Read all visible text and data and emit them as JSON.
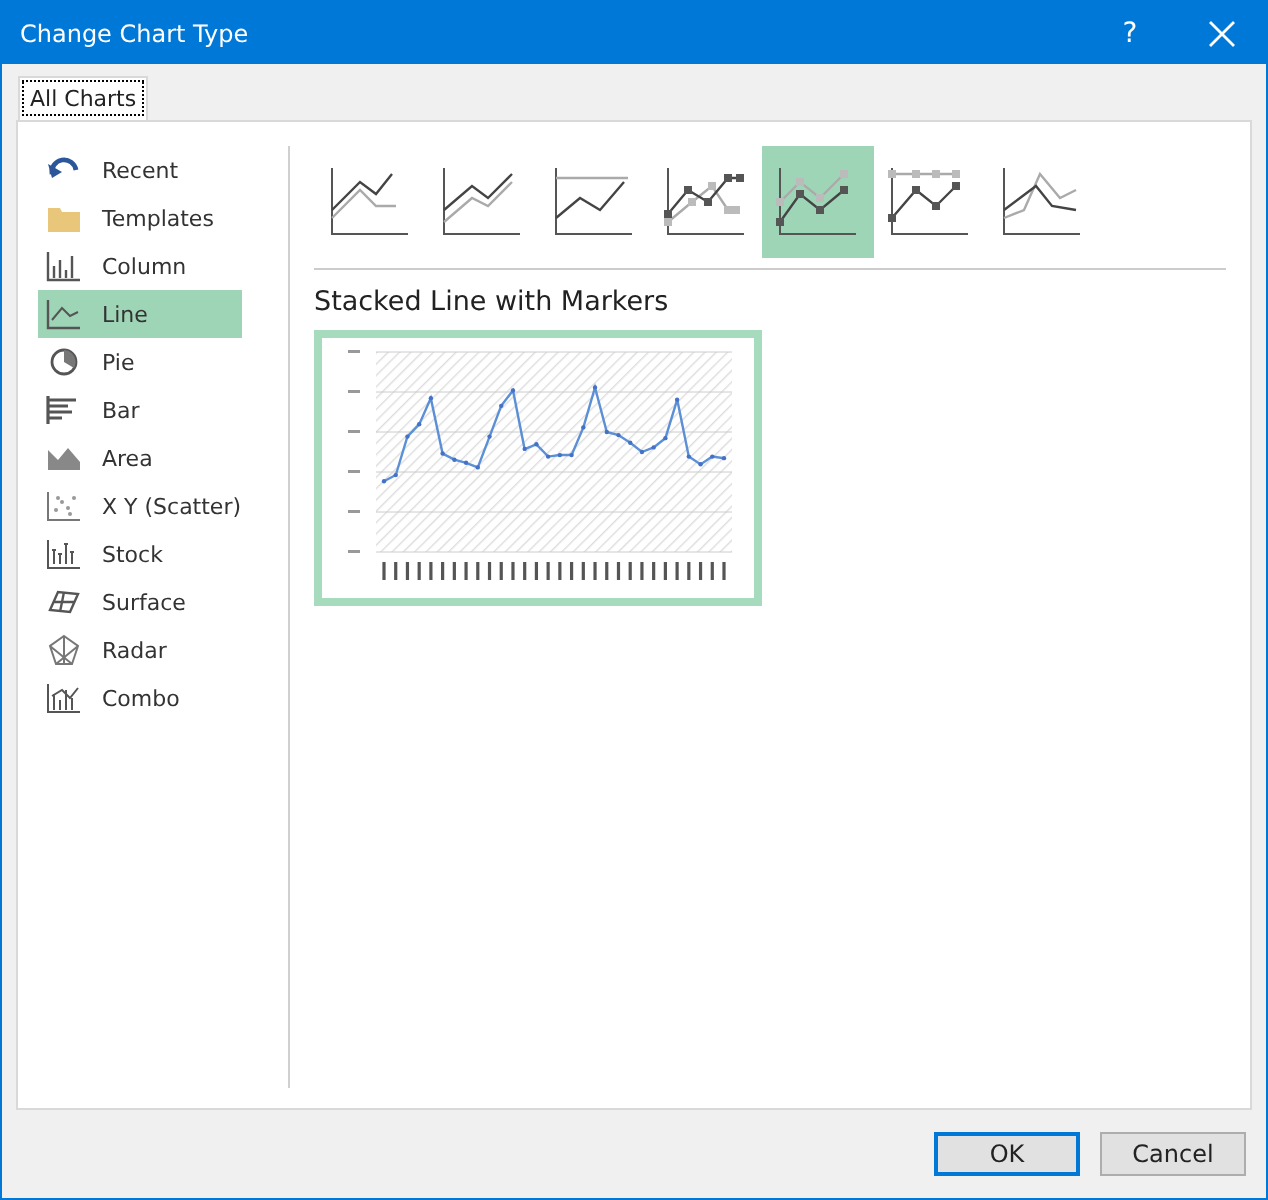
{
  "window": {
    "title": "Change Chart Type",
    "help": "?"
  },
  "tabs": [
    {
      "label": "All Charts",
      "selected": true
    }
  ],
  "chart_types": [
    {
      "label": "Recent",
      "selected": false
    },
    {
      "label": "Templates",
      "selected": false
    },
    {
      "label": "Column",
      "selected": false
    },
    {
      "label": "Line",
      "selected": true
    },
    {
      "label": "Pie",
      "selected": false
    },
    {
      "label": "Bar",
      "selected": false
    },
    {
      "label": "Area",
      "selected": false
    },
    {
      "label": "X Y (Scatter)",
      "selected": false
    },
    {
      "label": "Stock",
      "selected": false
    },
    {
      "label": "Surface",
      "selected": false
    },
    {
      "label": "Radar",
      "selected": false
    },
    {
      "label": "Combo",
      "selected": false
    }
  ],
  "subtypes": [
    {
      "selected": false
    },
    {
      "selected": false
    },
    {
      "selected": false
    },
    {
      "selected": false
    },
    {
      "selected": true
    },
    {
      "selected": false
    },
    {
      "selected": false
    }
  ],
  "preview": {
    "title": "Stacked Line with Markers"
  },
  "buttons": [
    {
      "label": "OK",
      "default": true
    },
    {
      "label": "Cancel",
      "default": false
    }
  ]
}
